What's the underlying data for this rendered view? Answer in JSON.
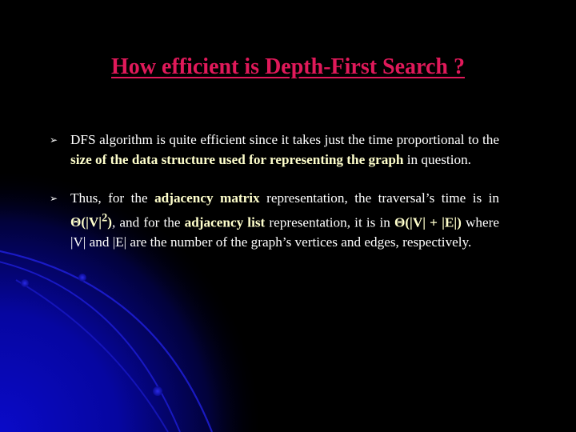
{
  "slide": {
    "title": "How efficient is Depth-First Search ?",
    "colors": {
      "background": "#000000",
      "title": "#E0195A",
      "text": "#FFFFFF",
      "highlight": "#FFFFCC",
      "decoration": "#1A1AD0"
    },
    "bullet_icon": "arrowhead-bullet-icon",
    "bullets": [
      {
        "segments": [
          {
            "text": "DFS algorithm is quite efficient since it takes just the time proportional to the ",
            "bold": false
          },
          {
            "text": "size of the data structure used for representing the graph",
            "bold": true
          },
          {
            "text": " in question.",
            "bold": false
          }
        ]
      },
      {
        "segments": [
          {
            "text": "Thus, for the ",
            "bold": false
          },
          {
            "text": "adjacency matrix",
            "bold": true
          },
          {
            "text": " representation, the traversal’s time is in ",
            "bold": false
          },
          {
            "text": "Θ(|V|",
            "bold": true
          },
          {
            "text": "2",
            "bold": true,
            "sup": true
          },
          {
            "text": ")",
            "bold": true
          },
          {
            "text": ", and for the ",
            "bold": false
          },
          {
            "text": "adjacency list",
            "bold": true
          },
          {
            "text": " representation, it is in ",
            "bold": false
          },
          {
            "text": "Θ(|V| + |E|)",
            "bold": true
          },
          {
            "text": " where |V| and |E| are the number of the graph’s vertices and edges, respectively.",
            "bold": false
          }
        ]
      }
    ]
  }
}
